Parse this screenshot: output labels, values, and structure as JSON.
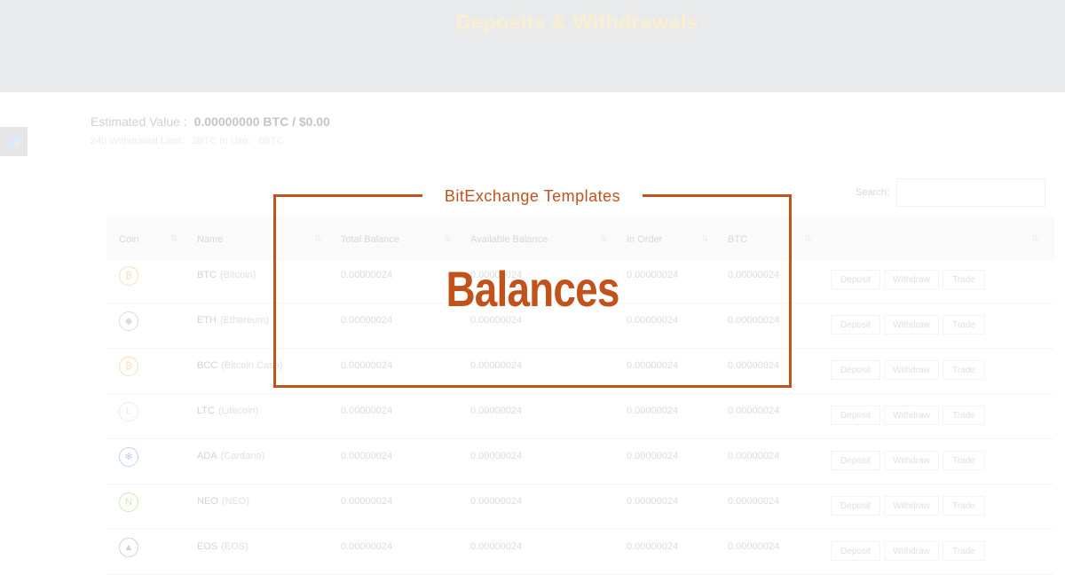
{
  "header": {
    "title": "Deposits & Withdrawals"
  },
  "summary": {
    "estimated_label": "Estimated Value :",
    "estimated_value": "0.00000000 BTC / $0.00",
    "limit_label": "24h Withdrawal Limit:",
    "limit_in_use": "2BTC In Use:",
    "limit_value": "0BTC"
  },
  "search": {
    "label": "Search:",
    "value": "",
    "placeholder": ""
  },
  "table": {
    "columns": [
      "Coin",
      "Name",
      "Total Balance",
      "Available Balance",
      "In Order",
      "BTC"
    ],
    "buttons": {
      "deposit": "Deposit",
      "withdraw": "Withdraw",
      "trade": "Trade"
    },
    "rows": [
      {
        "symbol": "BTC",
        "name": "(Bitcoin)",
        "total": "0.00000024",
        "available": "0.00000024",
        "in_order": "0.00000024",
        "btc": "0.00000024",
        "icon": "bitcoin-icon",
        "icon_glyph": "₿",
        "color": "#f7931a"
      },
      {
        "symbol": "ETH",
        "name": "(Ethereum)",
        "total": "0.00000024",
        "available": "0.00000024",
        "in_order": "0.00000024",
        "btc": "0.00000024",
        "icon": "ethereum-icon",
        "icon_glyph": "◆",
        "color": "#8a8a8a"
      },
      {
        "symbol": "BCC",
        "name": "(Bitcoin Cash)",
        "total": "0.00000024",
        "available": "0.00000024",
        "in_order": "0.00000024",
        "btc": "0.00000024",
        "icon": "bitcoin-cash-icon",
        "icon_glyph": "₿",
        "color": "#f7931a"
      },
      {
        "symbol": "LTC",
        "name": "(Litecoin)",
        "total": "0.00000024",
        "available": "0.00000024",
        "in_order": "0.00000024",
        "btc": "0.00000024",
        "icon": "litecoin-icon",
        "icon_glyph": "Ł",
        "color": "#bebebe"
      },
      {
        "symbol": "ADA",
        "name": "(Cardano)",
        "total": "0.00000024",
        "available": "0.00000024",
        "in_order": "0.00000024",
        "btc": "0.00000024",
        "icon": "cardano-icon",
        "icon_glyph": "✻",
        "color": "#3468d1"
      },
      {
        "symbol": "NEO",
        "name": "(NEO)",
        "total": "0.00000024",
        "available": "0.00000024",
        "in_order": "0.00000024",
        "btc": "0.00000024",
        "icon": "neo-icon",
        "icon_glyph": "N",
        "color": "#58bf00"
      },
      {
        "symbol": "EOS",
        "name": "(EOS)",
        "total": "0.00000024",
        "available": "0.00000024",
        "in_order": "0.00000024",
        "btc": "0.00000024",
        "icon": "eos-icon",
        "icon_glyph": "▲",
        "color": "#6b6b6b"
      }
    ]
  },
  "overlay": {
    "subtitle": "BitExchange Templates",
    "title": "Balances",
    "accent": "#c1521b"
  }
}
